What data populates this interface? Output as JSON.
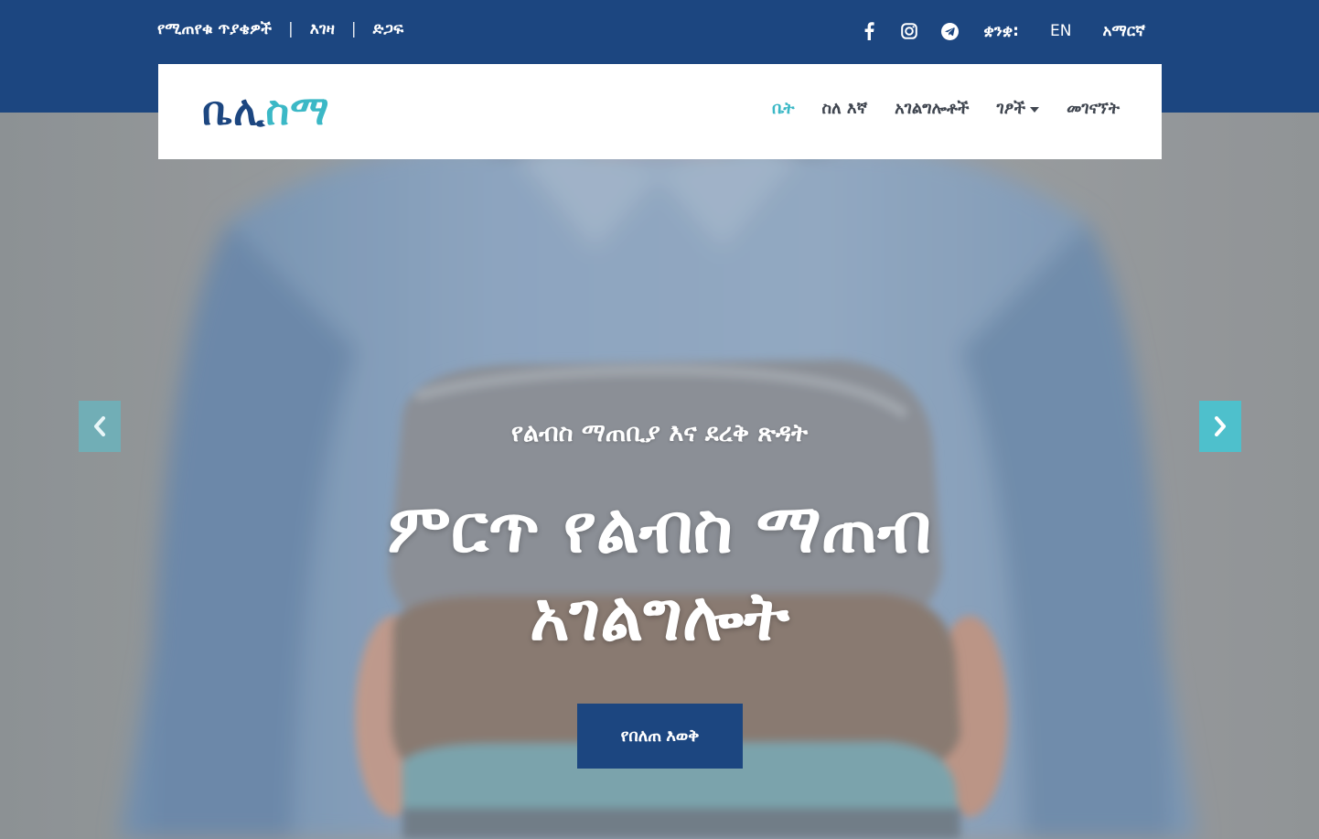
{
  "top_links": [
    "የሚጠየቁ ጥያቄዎች",
    "እገዛ",
    "ድጋፍ"
  ],
  "separator": "|",
  "social_icons": [
    "facebook-icon",
    "instagram-icon",
    "telegram-icon"
  ],
  "language": {
    "label": "ቋንቋ:",
    "options": [
      "EN",
      "አማርኛ"
    ]
  },
  "logo": {
    "part1": "ቤሊ",
    "part2": "ስማ"
  },
  "nav": {
    "items": [
      "ቤት",
      "ስለ እኛ",
      "አገልግሎቶች",
      "ገፆች",
      "መገናኘት"
    ],
    "active": "ቤት"
  },
  "hero": {
    "subtitle": "የልብስ ማጠቢያ እና ደረቅ ጽዳት",
    "title_line1": "ምርጥ የልብስ ማጠብ",
    "title_line2": "አገልግሎት",
    "cta": "የበለጠ እወቅ"
  },
  "carousel": {
    "prev_icon": "chevron-left-icon",
    "next_icon": "chevron-right-icon"
  },
  "colors": {
    "brand_blue": "#1c4680",
    "accent_teal": "#3bb8c6",
    "nav_text": "#404650"
  }
}
